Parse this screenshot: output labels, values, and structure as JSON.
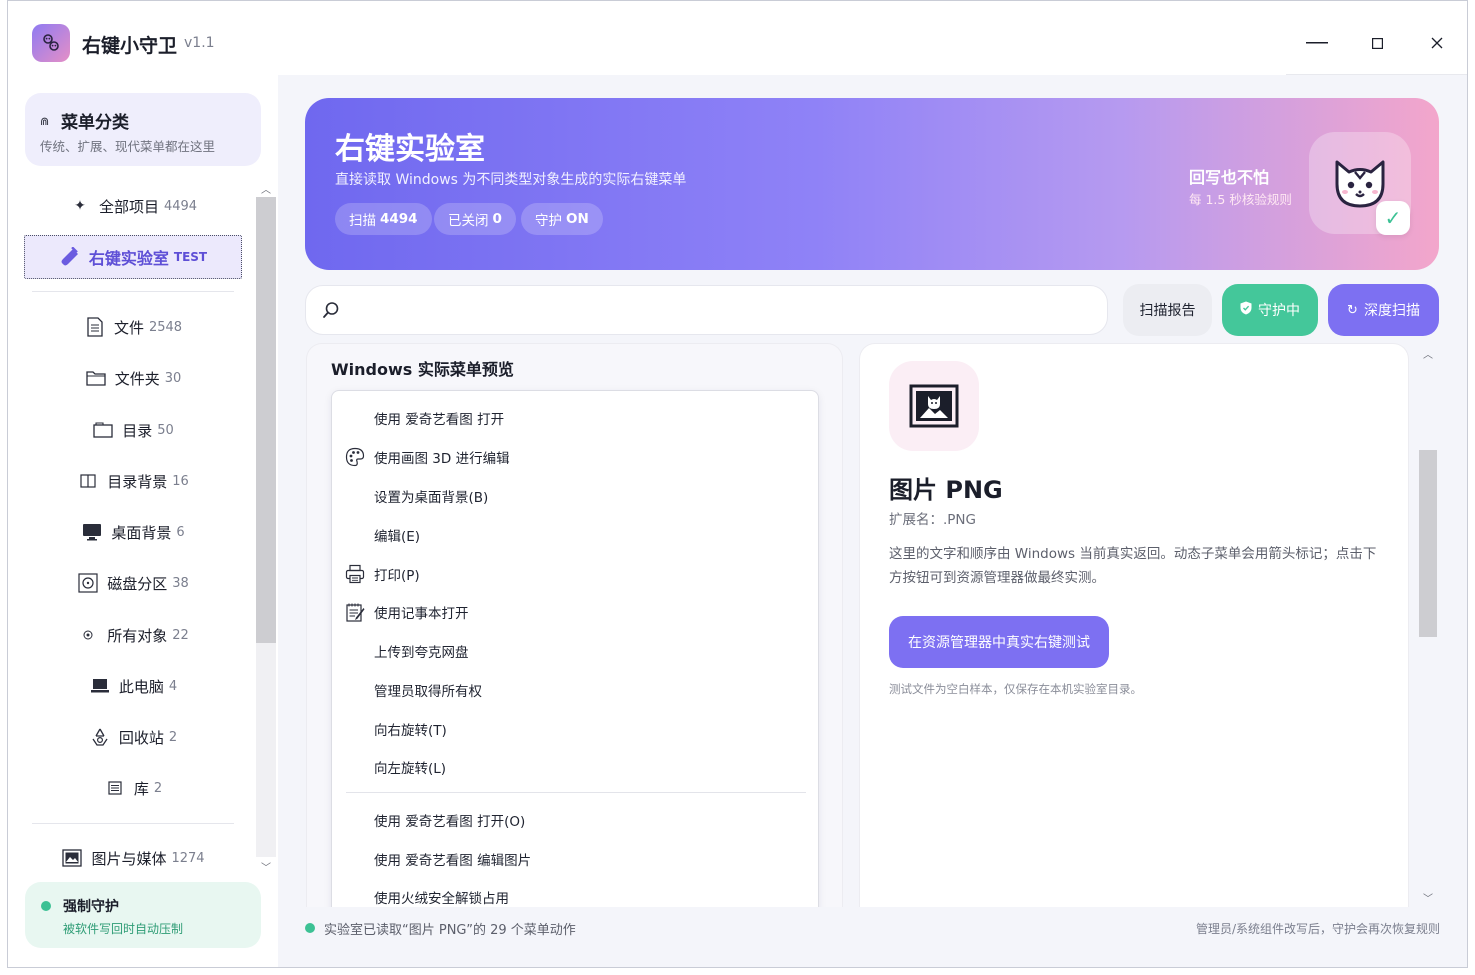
{
  "app": {
    "title": "右键小守卫",
    "version": "v1.1"
  },
  "window_controls": {
    "minimize": "—",
    "maximize": "☐",
    "close": "✕"
  },
  "sidebar": {
    "category_card": {
      "title": "菜单分类",
      "subtitle": "传统、扩展、现代菜单都在这里"
    },
    "items": [
      {
        "label": "全部项目",
        "count": "4494",
        "icon": "sparkle-icon"
      },
      {
        "label": "右键实验室",
        "count": "TEST",
        "icon": "flask-icon",
        "active": true
      },
      {
        "label": "文件",
        "count": "2548",
        "icon": "file-icon"
      },
      {
        "label": "文件夹",
        "count": "30",
        "icon": "folder-icon"
      },
      {
        "label": "目录",
        "count": "50",
        "icon": "directory-icon"
      },
      {
        "label": "目录背景",
        "count": "16",
        "icon": "columns-icon"
      },
      {
        "label": "桌面背景",
        "count": "6",
        "icon": "monitor-icon"
      },
      {
        "label": "磁盘分区",
        "count": "38",
        "icon": "disk-icon"
      },
      {
        "label": "所有对象",
        "count": "22",
        "icon": "target-icon"
      },
      {
        "label": "此电脑",
        "count": "4",
        "icon": "laptop-icon"
      },
      {
        "label": "回收站",
        "count": "2",
        "icon": "recycle-icon"
      },
      {
        "label": "库",
        "count": "2",
        "icon": "library-icon"
      },
      {
        "label": "图片与媒体",
        "count": "1274",
        "icon": "image-icon"
      }
    ],
    "guard_card": {
      "title": "强制守护",
      "subtitle": "被软件写回时自动压制"
    }
  },
  "hero": {
    "title": "右键实验室",
    "subtitle": "直接读取 Windows 为不同类型对象生成的实际右键菜单",
    "pills": [
      {
        "label": "扫描",
        "value": "4494"
      },
      {
        "label": "已关闭",
        "value": "0"
      },
      {
        "label": "守护",
        "value": "ON"
      }
    ],
    "right_title": "回写也不怕",
    "right_sub": "每 1.5 秒核验规则",
    "check": "✓"
  },
  "toolbar": {
    "search_placeholder": "",
    "report_label": "扫描报告",
    "guard_label": "守护中",
    "scan_label": "深度扫描"
  },
  "menu_preview": {
    "title": "Windows 实际菜单预览",
    "items": [
      {
        "label": "使用 爱奇艺看图 打开",
        "icon": ""
      },
      {
        "label": "使用画图 3D 进行编辑",
        "icon": "palette-icon"
      },
      {
        "label": "设置为桌面背景(B)",
        "icon": ""
      },
      {
        "label": "编辑(E)",
        "icon": ""
      },
      {
        "label": "打印(P)",
        "icon": "printer-icon"
      },
      {
        "label": "使用记事本打开",
        "icon": "notepad-icon"
      },
      {
        "label": "上传到夸克网盘",
        "icon": ""
      },
      {
        "label": "管理员取得所有权",
        "icon": ""
      },
      {
        "label": "向右旋转(T)",
        "icon": ""
      },
      {
        "label": "向左旋转(L)",
        "icon": ""
      },
      {
        "label": "使用 爱奇艺看图 打开(O)",
        "icon": ""
      },
      {
        "label": "使用 爱奇艺看图 编辑图片",
        "icon": ""
      },
      {
        "label": "使用火绒安全解锁占用",
        "icon": ""
      }
    ]
  },
  "detail": {
    "icon": "picture-icon",
    "name": "图片 PNG",
    "ext": "扩展名：.PNG",
    "desc": "这里的文字和顺序由 Windows 当前真实返回。动态子菜单会用箭头标记；点击下方按钮可到资源管理器做最终实测。",
    "button": "在资源管理器中真实右键测试",
    "note": "测试文件为空白样本，仅保存在本机实验室目录。"
  },
  "status": {
    "left": "实验室已读取“图片 PNG”的 29 个菜单动作",
    "right": "管理员/系统组件改写后，守护会再次恢复规则"
  },
  "colors": {
    "accent": "#7d70f2",
    "green": "#44c79a",
    "hero_start": "#6f68ef",
    "hero_end": "#f3a6cb"
  }
}
